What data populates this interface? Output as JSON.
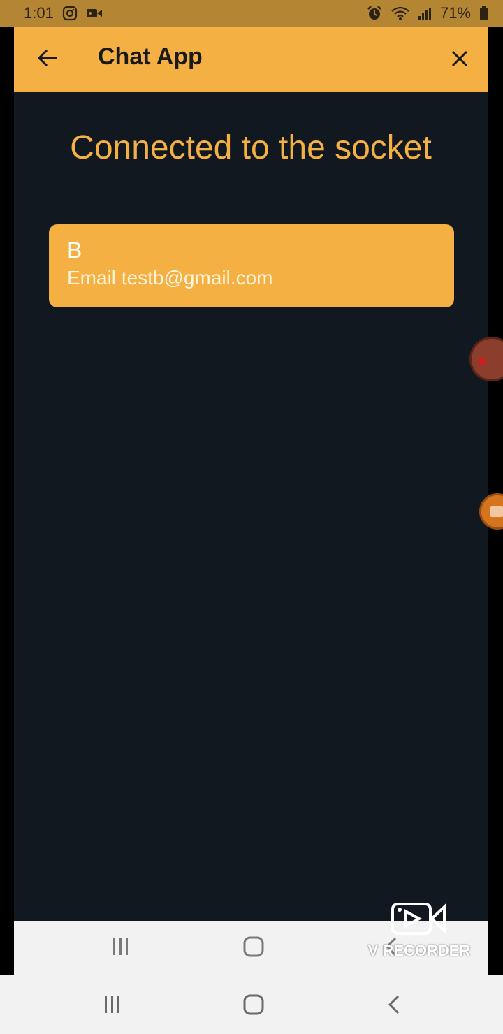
{
  "status_bar": {
    "time": "1:01",
    "battery": "71%",
    "icons": [
      "instagram-icon",
      "video-icon",
      "alarm-icon",
      "wifi-icon",
      "signal-icon",
      "battery-icon"
    ]
  },
  "app_bar": {
    "title": "Chat App",
    "back_icon": "arrow-left-icon",
    "close_icon": "close-icon"
  },
  "main": {
    "heading": "Connected to the socket",
    "users": [
      {
        "name": "B",
        "email": "Email testb@gmail.com"
      }
    ]
  },
  "watermark": {
    "text": "V RECORDER"
  },
  "nav": {
    "icons": [
      "recents-icon",
      "home-icon",
      "back-icon"
    ]
  },
  "colors": {
    "accent": "#f4b042",
    "background": "#121820",
    "status_bar": "#b48633"
  }
}
